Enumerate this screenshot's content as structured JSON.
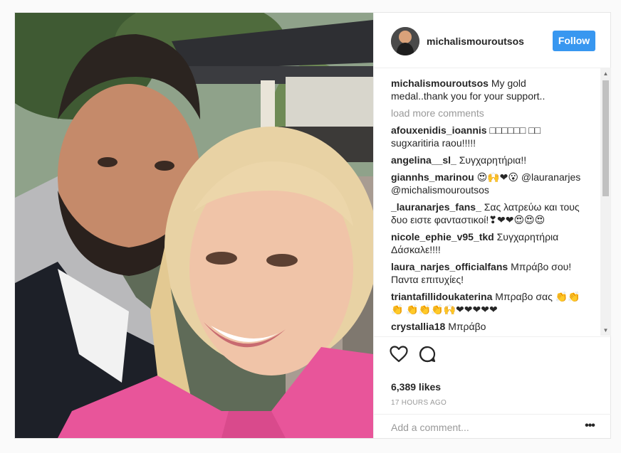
{
  "post": {
    "username": "michalismouroutsos",
    "follow_label": "Follow",
    "caption_user": "michalismouroutsos",
    "caption_text": "My gold medal..thank you for your support..",
    "load_more": "load more comments",
    "comments": [
      {
        "user": "afouxenidis_ioannis",
        "text": "□□□□□□ □□ sugxaritiria raou!!!!!"
      },
      {
        "user": "angelina__sl_",
        "text": "Συγχαρητήρια!!"
      },
      {
        "user": "giannhs_marinou",
        "text": "😍🙌❤😮 @lauranarjes @michalismouroutsos"
      },
      {
        "user": "_lauranarjes_fans_",
        "text": "Σας λατρεύω και τους δυο ειστε φανταστικοί!❣❤❤😍😍😍"
      },
      {
        "user": "nicole_ephie_v95_tkd",
        "text": "Συγχαρητήρια Δάσκαλε!!!!"
      },
      {
        "user": "laura_narjes_officialfans",
        "text": "Μπράβο σου! Παντα επιτυχίες!"
      },
      {
        "user": "triantafillidoukaterina",
        "text": "Μπραβο σας 👏👏👏 👏👏👏🙌❤❤❤❤❤"
      },
      {
        "user": "crystallia18",
        "text": "Μπράβο"
      }
    ],
    "likes": "6,389 likes",
    "time": "17 HOURS AGO",
    "add_comment_placeholder": "Add a comment...",
    "more_icon": "•••"
  },
  "icons": {
    "heart": "heart-icon",
    "comment": "comment-bubble-icon",
    "more": "more-options-icon"
  },
  "colors": {
    "accent": "#3897f0",
    "border": "#efefef",
    "muted": "#999999"
  }
}
